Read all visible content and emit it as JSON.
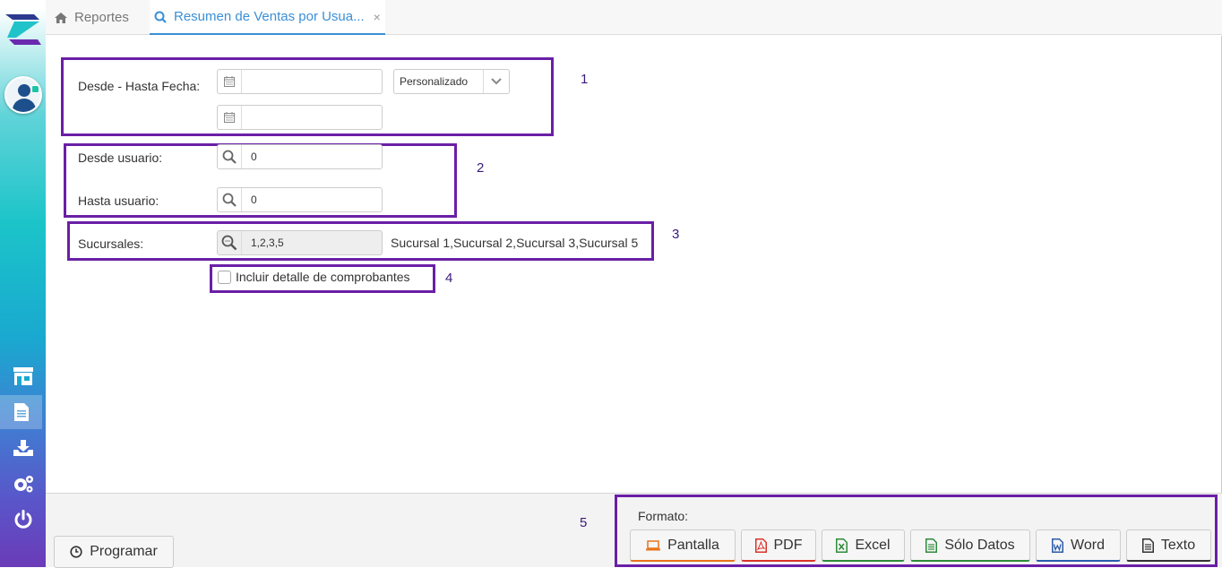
{
  "tabs": [
    {
      "label": "Reportes",
      "icon": "home-icon"
    },
    {
      "label": "Resumen de Ventas por Usua...",
      "icon": "search-icon",
      "close": "×"
    }
  ],
  "form": {
    "date_range_label": "Desde - Hasta Fecha:",
    "date_from_value": "",
    "date_to_value": "",
    "period_select_value": "Personalizado",
    "from_user_label": "Desde usuario:",
    "from_user_value": "0",
    "to_user_label": "Hasta usuario:",
    "to_user_value": "0",
    "branches_label": "Sucursales:",
    "branches_value": "1,2,3,5",
    "branches_desc": "Sucursal 1,Sucursal 2,Sucursal 3,Sucursal 5",
    "detail_checkbox_label": "Incluir detalle de comprobantes",
    "detail_checked": false
  },
  "annotations": [
    "1",
    "2",
    "3",
    "4",
    "5"
  ],
  "footer": {
    "schedule_label": "Programar",
    "format_label": "Formato:",
    "buttons": [
      {
        "label": "Pantalla",
        "icon": "monitor-icon",
        "color": "#e8731a"
      },
      {
        "label": "PDF",
        "icon": "pdf-icon",
        "color": "#d9342b"
      },
      {
        "label": "Excel",
        "icon": "excel-icon",
        "color": "#2e8b3a"
      },
      {
        "label": "Sólo Datos",
        "icon": "data-file-icon",
        "color": "#2e8b3a"
      },
      {
        "label": "Word",
        "icon": "word-icon",
        "color": "#2b5bab"
      },
      {
        "label": "Texto",
        "icon": "text-file-icon",
        "color": "#333333"
      }
    ]
  },
  "colors": {
    "accent": "#3a8fd6",
    "highlight": "#6a1fa6"
  }
}
